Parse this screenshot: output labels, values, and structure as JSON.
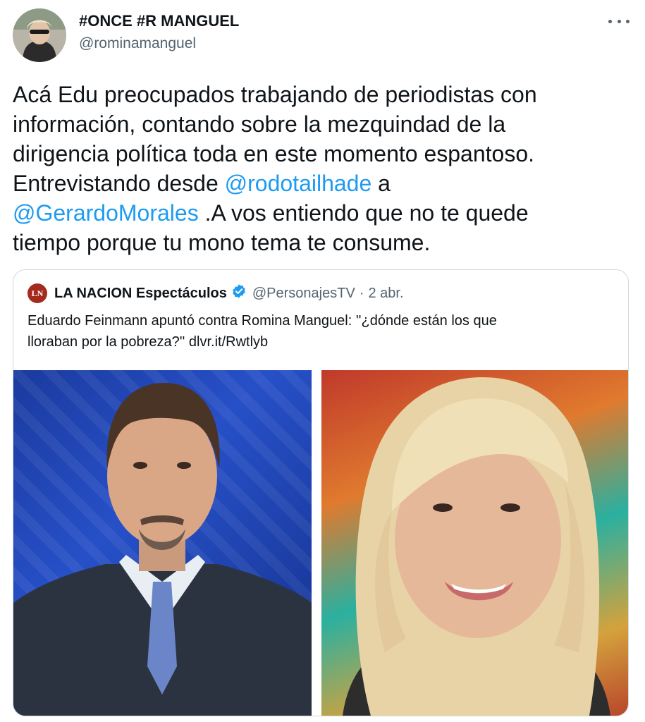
{
  "author": {
    "display_name": "#ONCE #R MANGUEL",
    "handle": "@rominamanguel",
    "avatar_icon": "user-avatar-photo"
  },
  "menu_icon": "more-horizontal-icon",
  "tweet": {
    "line1": "Acá Edu preocupados trabajando de periodistas con",
    "line2": "información, contando sobre la mezquindad de la",
    "line3": "dirigencia política toda en este momento espantoso.",
    "line4_pre": "Entrevistando desde ",
    "mention1": "@rodotailhade",
    "line4_post": " a",
    "mention2": "@GerardoMorales",
    "line5_post": " .A vos entiendo que no te quede",
    "line6": "tiempo porque tu mono tema te consume."
  },
  "quote": {
    "logo_text": "LN",
    "name": "LA NACION Espectáculos",
    "verified_icon": "verified-badge-icon",
    "handle": "@PersonajesTV",
    "separator": "·",
    "date": "2 abr.",
    "text_line1": "Eduardo Feinmann apuntó contra Romina Manguel: ''¿dónde están los que",
    "text_line2": "lloraban por la pobreza?'' dlvr.it/Rwtlyb",
    "images": [
      "man-portrait-photo",
      "woman-portrait-photo"
    ]
  },
  "colors": {
    "link": "#1d9bf0",
    "secondary_text": "#536471",
    "border": "#cfd9de"
  }
}
